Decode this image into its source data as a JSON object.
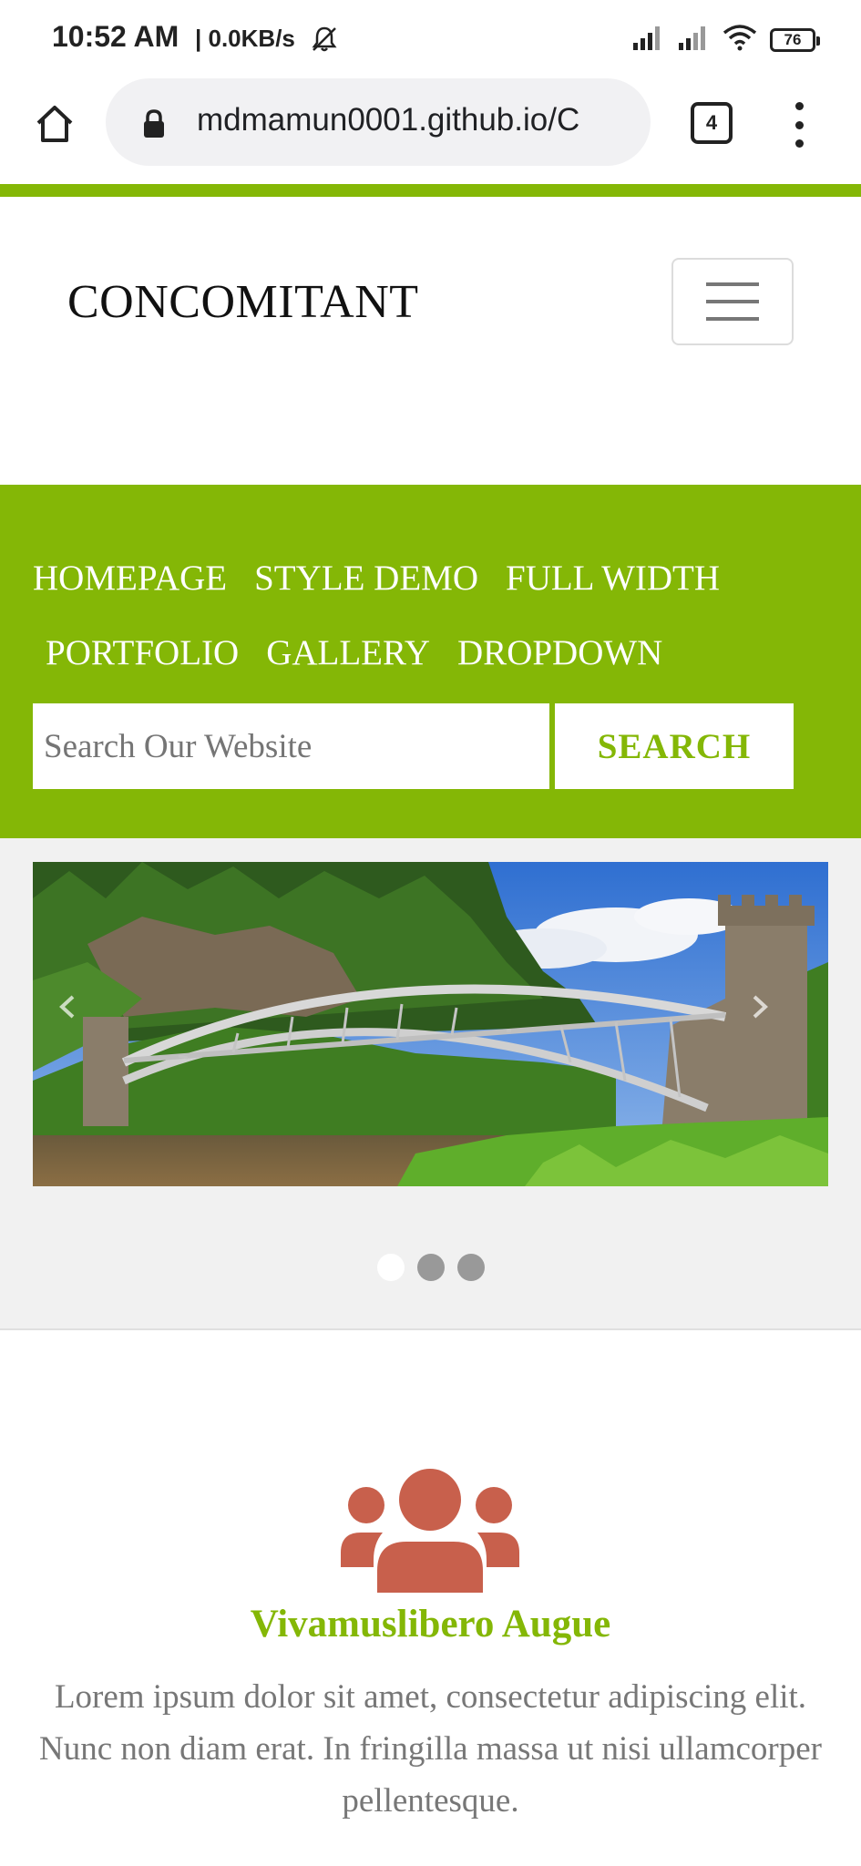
{
  "status_bar": {
    "time": "10:52 AM",
    "net_speed": "| 0.0KB/s",
    "battery": "76"
  },
  "browser": {
    "url": "mdmamun0001.github.io/C",
    "tab_count": "4"
  },
  "header": {
    "logo": "CONCOMITANT"
  },
  "nav": {
    "row1": [
      {
        "label": "HOMEPAGE"
      },
      {
        "label": "STYLE DEMO"
      },
      {
        "label": "FULL WIDTH"
      }
    ],
    "row2": [
      {
        "label": "PORTFOLIO"
      },
      {
        "label": "GALLERY"
      },
      {
        "label": "DROPDOWN"
      }
    ]
  },
  "search": {
    "placeholder": "Search Our Website",
    "button_label": "SEARCH"
  },
  "slider": {
    "slide_count": 3,
    "active_index": 0
  },
  "feature": {
    "icon": "users-icon",
    "title": "Vivamuslibero Augue",
    "text": "Lorem ipsum dolor sit amet, consectetur adipiscing elit. Nunc non diam erat. In fringilla massa ut nisi ullamcorper pellentesque."
  },
  "colors": {
    "accent": "#84b706",
    "icon": "#c8604c"
  }
}
